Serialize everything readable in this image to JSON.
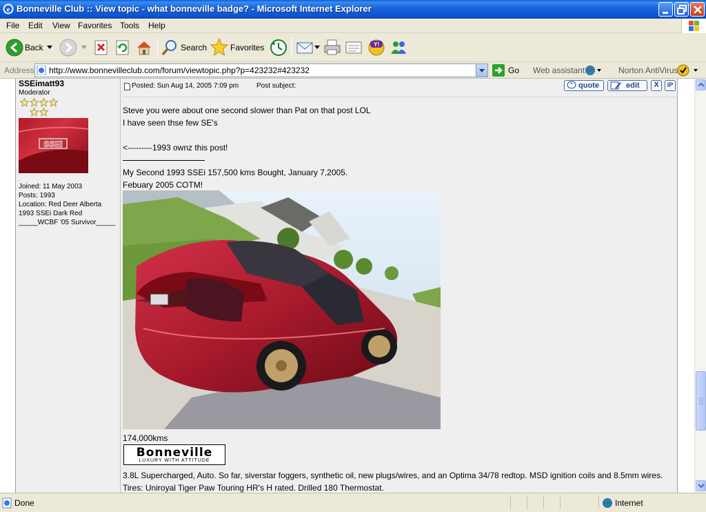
{
  "window": {
    "title": "Bonneville Club :: View topic - what bonneville badge? - Microsoft Internet Explorer"
  },
  "menu": [
    "File",
    "Edit",
    "View",
    "Favorites",
    "Tools",
    "Help"
  ],
  "toolbar": {
    "back_label": "Back",
    "search_label": "Search",
    "favorites_label": "Favorites"
  },
  "address": {
    "label": "Address",
    "url": "http://www.bonnevilleclub.com/forum/viewtopic.php?p=423232#423232",
    "go_label": "Go",
    "web_assistant": "Web assistant",
    "norton": "Norton AntiVirus"
  },
  "post": {
    "author": {
      "username": "SSEimatt93",
      "rank": "Moderator",
      "stars": 6,
      "joined": "Joined: 11 May 2003",
      "posts": "Posts: 1993",
      "location": "Location: Red Deer Alberta",
      "car": "1993 SSEi Dark Red",
      "survivor": "_____WCBF '05 Survivor_____"
    },
    "posted": "Posted: Sun Aug 14, 2005 7:09 pm",
    "subject_label": "Post subject:",
    "buttons": {
      "quote": "quote",
      "edit": "edit",
      "delete": "X",
      "ip": "IP"
    },
    "lines": [
      "Steve you were about one second slower than Pat on that post LOL",
      "I have seen thse few SE's",
      "<---------1993 ownz this post!"
    ],
    "signature": {
      "line1": "My Second 1993 SSEi 157,500 kms Bought, January 7,2005.",
      "line2": "Febuary 2005 COTM!",
      "kms": "174,000kms",
      "logo_main": "Bonneville",
      "logo_tag": "LUXURY WITH ATTITUDE",
      "line3": "3.8L Supercharged, Auto. So far, siverstar foggers, synthetic oil, new plugs/wires, and an Optima 34/78 redtop. MSD ignition coils and 8.5mm wires.",
      "line4": "Tires: Uniroyal Tiger Paw Touring HR's H rated. Drilled 180 Thermostat."
    }
  },
  "status": {
    "text": "Done",
    "zone": "Internet"
  },
  "colors": {
    "titlebar": "#0c55cf",
    "chrome": "#ece9d8",
    "post_bg": "#efefef"
  }
}
